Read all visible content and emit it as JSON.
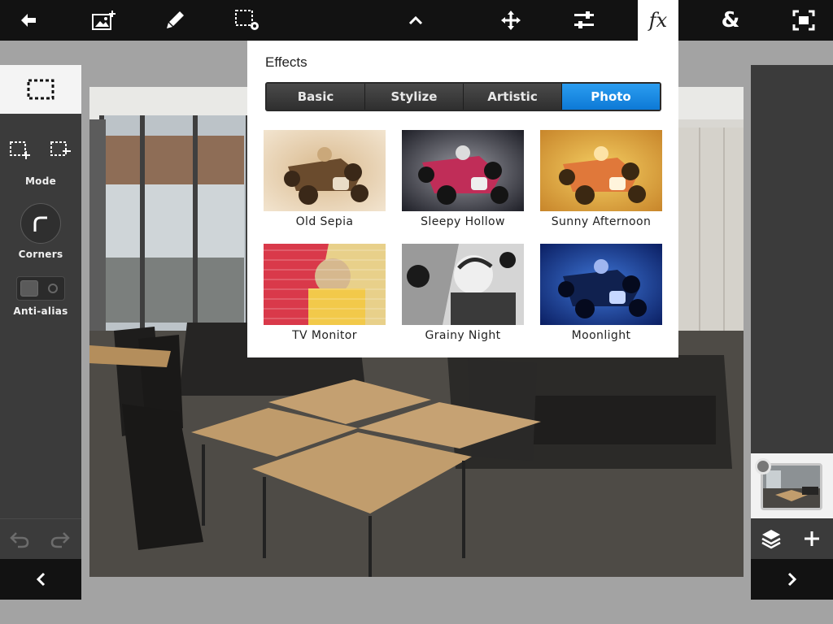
{
  "toolbar": {
    "icons": [
      "back-arrow-icon",
      "add-image-icon",
      "brush-icon",
      "selection-settings-icon",
      "chevron-up-icon",
      "move-icon",
      "sliders-icon",
      "fx-icon",
      "ampersand-icon",
      "fullscreen-icon"
    ],
    "fx_label": "fx",
    "amp_label": "&"
  },
  "left_panel": {
    "mode_label": "Mode",
    "corners_label": "Corners",
    "antialias_label": "Anti-alias"
  },
  "effects": {
    "title": "Effects",
    "tabs": [
      "Basic",
      "Stylize",
      "Artistic",
      "Photo"
    ],
    "selected_tab": "Photo",
    "items": [
      {
        "label": "Old Sepia"
      },
      {
        "label": "Sleepy Hollow"
      },
      {
        "label": "Sunny Afternoon"
      },
      {
        "label": "TV Monitor"
      },
      {
        "label": "Grainy Night"
      },
      {
        "label": "Moonlight"
      }
    ]
  },
  "colors": {
    "toolbar_bg": "#121212",
    "panel_bg": "#3b3b3b",
    "accent_blue": "#1a8ce6",
    "workspace_bg": "#a3a3a3"
  }
}
